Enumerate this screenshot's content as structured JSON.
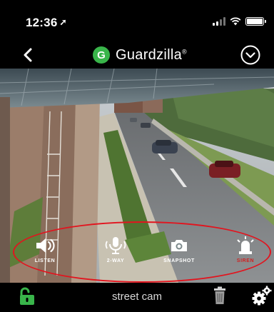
{
  "status_bar": {
    "time": "12:36",
    "location_glyph": "➚",
    "icons": [
      "signal-icon",
      "wifi-icon",
      "battery-icon"
    ]
  },
  "nav": {
    "brand_initial": "G",
    "brand_name": "Guardzilla",
    "brand_mark": "®",
    "brand_color": "#39b54a",
    "icons": [
      "back-chevron-icon",
      "dropdown-circle-icon"
    ]
  },
  "controls": {
    "listen_label": "LISTEN",
    "twoway_label": "2-WAY",
    "snapshot_label": "SNAPSHOT",
    "siren_label": "SIREN",
    "siren_color": "#d02222"
  },
  "footer": {
    "camera_name": "street cam",
    "lock_color": "#39b54a",
    "icons": [
      "unlock-icon",
      "trash-icon",
      "gear-icon"
    ]
  },
  "highlight_color": "#e2141e"
}
